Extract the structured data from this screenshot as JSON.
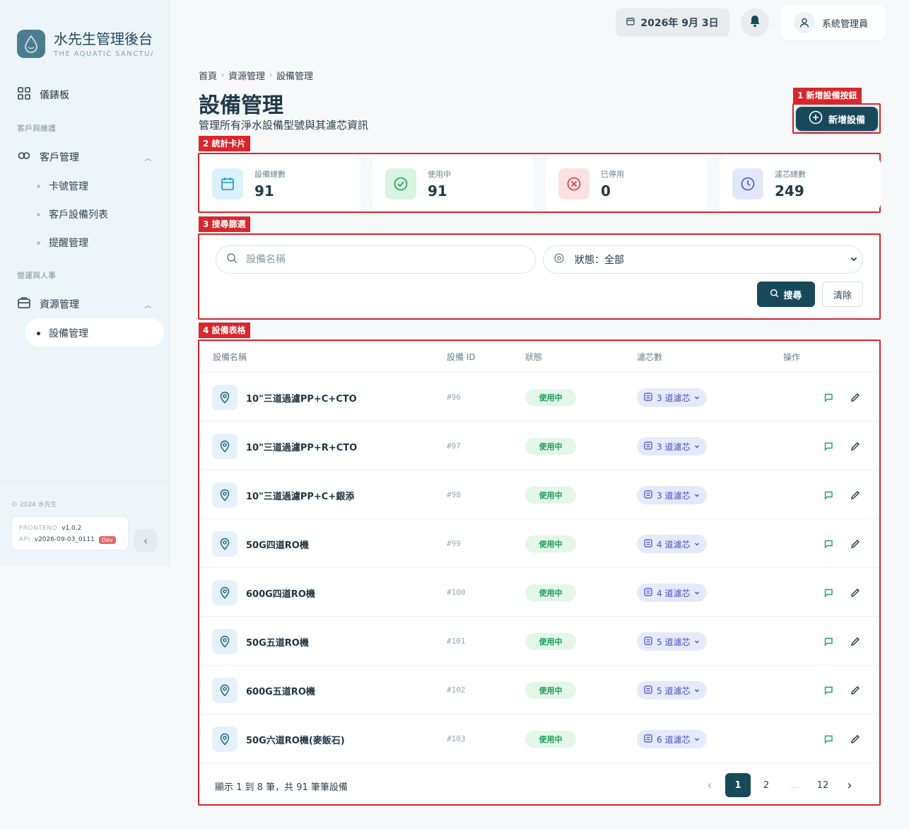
{
  "sidebar": {
    "brand_title": "水先生管理後台",
    "brand_subtitle": "THE AQUATIC SANCTUARY",
    "dashboard_label": "儀錶板",
    "section_customer": "客戶與維護",
    "customer_mgmt_label": "客戶管理",
    "customer_sub": [
      "卡號管理",
      "客戶設備列表",
      "提醒管理"
    ],
    "section_ops": "營運與人事",
    "resource_mgmt_label": "資源管理",
    "resource_sub": [
      "設備管理"
    ],
    "copyright": "© 2024 水先生",
    "frontend_key": "FRONTEND",
    "frontend_version": "v1.0.2",
    "api_key": "API",
    "api_version": "v2026-09-03_0111",
    "env_badge": "Dev"
  },
  "topbar": {
    "date": "2026年 9月 3日",
    "user_name": "系統管理員"
  },
  "header": {
    "breadcrumb": [
      "首頁",
      "資源管理",
      "設備管理"
    ],
    "title": "設備管理",
    "subtitle": "管理所有淨水設備型號與其濾芯資訊",
    "add_button": "新增設備"
  },
  "annotations": {
    "a1": "1 新增設備按鈕",
    "a2": "2 統計卡片",
    "a3": "3 搜尋篩選",
    "a4": "4 設備表格"
  },
  "stats": [
    {
      "label": "設備總數",
      "value": "91",
      "color": "#d9f1fb",
      "icon": "calendar-icon"
    },
    {
      "label": "使用中",
      "value": "91",
      "color": "#d7f3e3",
      "icon": "check-circle-icon"
    },
    {
      "label": "已停用",
      "value": "0",
      "color": "#fbe1e3",
      "icon": "x-circle-icon"
    },
    {
      "label": "濾芯總數",
      "value": "249",
      "color": "#e3e5f9",
      "icon": "clock-icon"
    }
  ],
  "search": {
    "placeholder": "設備名稱",
    "status_label": "狀態：全部",
    "search_button": "搜尋",
    "clear_button": "清除"
  },
  "table": {
    "columns": [
      "設備名稱",
      "設備 ID",
      "狀態",
      "濾芯數",
      "操作"
    ],
    "rows": [
      {
        "name": "10\"三道過濾PP+C+CTO",
        "id": "#96",
        "status": "使用中",
        "filters": "3 道濾芯"
      },
      {
        "name": "10\"三道過濾PP+R+CTO",
        "id": "#97",
        "status": "使用中",
        "filters": "3 道濾芯"
      },
      {
        "name": "10\"三道過濾PP+C+銀添",
        "id": "#98",
        "status": "使用中",
        "filters": "3 道濾芯"
      },
      {
        "name": "50G四道RO機",
        "id": "#99",
        "status": "使用中",
        "filters": "4 道濾芯"
      },
      {
        "name": "600G四道RO機",
        "id": "#100",
        "status": "使用中",
        "filters": "4 道濾芯"
      },
      {
        "name": "50G五道RO機",
        "id": "#101",
        "status": "使用中",
        "filters": "5 道濾芯"
      },
      {
        "name": "600G五道RO機",
        "id": "#102",
        "status": "使用中",
        "filters": "5 道濾芯"
      },
      {
        "name": "50G六道RO機(麥飯石)",
        "id": "#103",
        "status": "使用中",
        "filters": "6 道濾芯"
      }
    ]
  },
  "pagination": {
    "info": "顯示 1 到 8 筆，共 91 筆筆設備",
    "pages": [
      "1",
      "2",
      "...",
      "12"
    ]
  },
  "colors": {
    "primary": "#17495a",
    "annotation": "#d9262c",
    "status_active_bg": "#e2f6e9",
    "status_active_text": "#1a9a55",
    "filter_badge_bg": "#e6e8fb",
    "filter_badge_text": "#4a4fbf"
  }
}
